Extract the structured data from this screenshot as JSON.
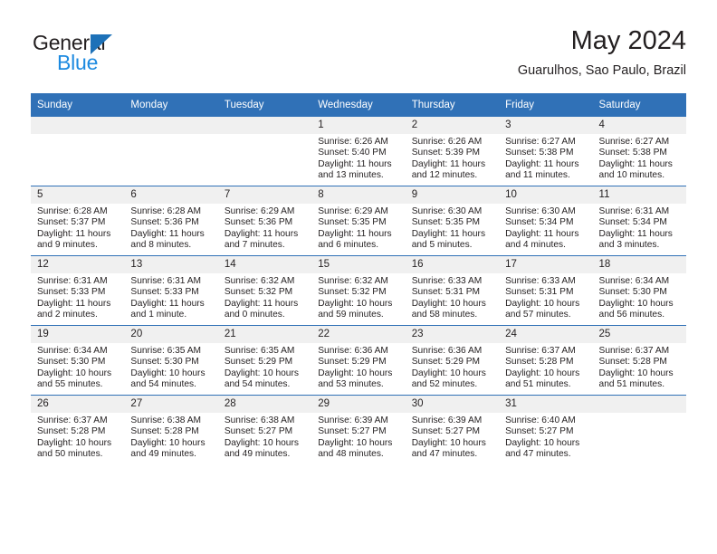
{
  "brand": {
    "name_top": "General",
    "name_bottom": "Blue",
    "triangle_color": "#1d71b8",
    "top_color": "#231f20",
    "bottom_color": "#1d8ae0"
  },
  "header": {
    "title": "May 2024",
    "subtitle": "Guarulhos, Sao Paulo, Brazil"
  },
  "theme": {
    "header_blue": "#3071b7",
    "daynum_band": "#f0f0f0",
    "text": "#231f20"
  },
  "calendar": {
    "weekday_headers": [
      "Sunday",
      "Monday",
      "Tuesday",
      "Wednesday",
      "Thursday",
      "Friday",
      "Saturday"
    ],
    "weeks": [
      [
        {
          "day": "",
          "blank": true
        },
        {
          "day": "",
          "blank": true
        },
        {
          "day": "",
          "blank": true
        },
        {
          "day": "1",
          "sunrise": "Sunrise: 6:26 AM",
          "sunset": "Sunset: 5:40 PM",
          "daylight_1": "Daylight: 11 hours",
          "daylight_2": "and 13 minutes."
        },
        {
          "day": "2",
          "sunrise": "Sunrise: 6:26 AM",
          "sunset": "Sunset: 5:39 PM",
          "daylight_1": "Daylight: 11 hours",
          "daylight_2": "and 12 minutes."
        },
        {
          "day": "3",
          "sunrise": "Sunrise: 6:27 AM",
          "sunset": "Sunset: 5:38 PM",
          "daylight_1": "Daylight: 11 hours",
          "daylight_2": "and 11 minutes."
        },
        {
          "day": "4",
          "sunrise": "Sunrise: 6:27 AM",
          "sunset": "Sunset: 5:38 PM",
          "daylight_1": "Daylight: 11 hours",
          "daylight_2": "and 10 minutes."
        }
      ],
      [
        {
          "day": "5",
          "sunrise": "Sunrise: 6:28 AM",
          "sunset": "Sunset: 5:37 PM",
          "daylight_1": "Daylight: 11 hours",
          "daylight_2": "and 9 minutes."
        },
        {
          "day": "6",
          "sunrise": "Sunrise: 6:28 AM",
          "sunset": "Sunset: 5:36 PM",
          "daylight_1": "Daylight: 11 hours",
          "daylight_2": "and 8 minutes."
        },
        {
          "day": "7",
          "sunrise": "Sunrise: 6:29 AM",
          "sunset": "Sunset: 5:36 PM",
          "daylight_1": "Daylight: 11 hours",
          "daylight_2": "and 7 minutes."
        },
        {
          "day": "8",
          "sunrise": "Sunrise: 6:29 AM",
          "sunset": "Sunset: 5:35 PM",
          "daylight_1": "Daylight: 11 hours",
          "daylight_2": "and 6 minutes."
        },
        {
          "day": "9",
          "sunrise": "Sunrise: 6:30 AM",
          "sunset": "Sunset: 5:35 PM",
          "daylight_1": "Daylight: 11 hours",
          "daylight_2": "and 5 minutes."
        },
        {
          "day": "10",
          "sunrise": "Sunrise: 6:30 AM",
          "sunset": "Sunset: 5:34 PM",
          "daylight_1": "Daylight: 11 hours",
          "daylight_2": "and 4 minutes."
        },
        {
          "day": "11",
          "sunrise": "Sunrise: 6:31 AM",
          "sunset": "Sunset: 5:34 PM",
          "daylight_1": "Daylight: 11 hours",
          "daylight_2": "and 3 minutes."
        }
      ],
      [
        {
          "day": "12",
          "sunrise": "Sunrise: 6:31 AM",
          "sunset": "Sunset: 5:33 PM",
          "daylight_1": "Daylight: 11 hours",
          "daylight_2": "and 2 minutes."
        },
        {
          "day": "13",
          "sunrise": "Sunrise: 6:31 AM",
          "sunset": "Sunset: 5:33 PM",
          "daylight_1": "Daylight: 11 hours",
          "daylight_2": "and 1 minute."
        },
        {
          "day": "14",
          "sunrise": "Sunrise: 6:32 AM",
          "sunset": "Sunset: 5:32 PM",
          "daylight_1": "Daylight: 11 hours",
          "daylight_2": "and 0 minutes."
        },
        {
          "day": "15",
          "sunrise": "Sunrise: 6:32 AM",
          "sunset": "Sunset: 5:32 PM",
          "daylight_1": "Daylight: 10 hours",
          "daylight_2": "and 59 minutes."
        },
        {
          "day": "16",
          "sunrise": "Sunrise: 6:33 AM",
          "sunset": "Sunset: 5:31 PM",
          "daylight_1": "Daylight: 10 hours",
          "daylight_2": "and 58 minutes."
        },
        {
          "day": "17",
          "sunrise": "Sunrise: 6:33 AM",
          "sunset": "Sunset: 5:31 PM",
          "daylight_1": "Daylight: 10 hours",
          "daylight_2": "and 57 minutes."
        },
        {
          "day": "18",
          "sunrise": "Sunrise: 6:34 AM",
          "sunset": "Sunset: 5:30 PM",
          "daylight_1": "Daylight: 10 hours",
          "daylight_2": "and 56 minutes."
        }
      ],
      [
        {
          "day": "19",
          "sunrise": "Sunrise: 6:34 AM",
          "sunset": "Sunset: 5:30 PM",
          "daylight_1": "Daylight: 10 hours",
          "daylight_2": "and 55 minutes."
        },
        {
          "day": "20",
          "sunrise": "Sunrise: 6:35 AM",
          "sunset": "Sunset: 5:30 PM",
          "daylight_1": "Daylight: 10 hours",
          "daylight_2": "and 54 minutes."
        },
        {
          "day": "21",
          "sunrise": "Sunrise: 6:35 AM",
          "sunset": "Sunset: 5:29 PM",
          "daylight_1": "Daylight: 10 hours",
          "daylight_2": "and 54 minutes."
        },
        {
          "day": "22",
          "sunrise": "Sunrise: 6:36 AM",
          "sunset": "Sunset: 5:29 PM",
          "daylight_1": "Daylight: 10 hours",
          "daylight_2": "and 53 minutes."
        },
        {
          "day": "23",
          "sunrise": "Sunrise: 6:36 AM",
          "sunset": "Sunset: 5:29 PM",
          "daylight_1": "Daylight: 10 hours",
          "daylight_2": "and 52 minutes."
        },
        {
          "day": "24",
          "sunrise": "Sunrise: 6:37 AM",
          "sunset": "Sunset: 5:28 PM",
          "daylight_1": "Daylight: 10 hours",
          "daylight_2": "and 51 minutes."
        },
        {
          "day": "25",
          "sunrise": "Sunrise: 6:37 AM",
          "sunset": "Sunset: 5:28 PM",
          "daylight_1": "Daylight: 10 hours",
          "daylight_2": "and 51 minutes."
        }
      ],
      [
        {
          "day": "26",
          "sunrise": "Sunrise: 6:37 AM",
          "sunset": "Sunset: 5:28 PM",
          "daylight_1": "Daylight: 10 hours",
          "daylight_2": "and 50 minutes."
        },
        {
          "day": "27",
          "sunrise": "Sunrise: 6:38 AM",
          "sunset": "Sunset: 5:28 PM",
          "daylight_1": "Daylight: 10 hours",
          "daylight_2": "and 49 minutes."
        },
        {
          "day": "28",
          "sunrise": "Sunrise: 6:38 AM",
          "sunset": "Sunset: 5:27 PM",
          "daylight_1": "Daylight: 10 hours",
          "daylight_2": "and 49 minutes."
        },
        {
          "day": "29",
          "sunrise": "Sunrise: 6:39 AM",
          "sunset": "Sunset: 5:27 PM",
          "daylight_1": "Daylight: 10 hours",
          "daylight_2": "and 48 minutes."
        },
        {
          "day": "30",
          "sunrise": "Sunrise: 6:39 AM",
          "sunset": "Sunset: 5:27 PM",
          "daylight_1": "Daylight: 10 hours",
          "daylight_2": "and 47 minutes."
        },
        {
          "day": "31",
          "sunrise": "Sunrise: 6:40 AM",
          "sunset": "Sunset: 5:27 PM",
          "daylight_1": "Daylight: 10 hours",
          "daylight_2": "and 47 minutes."
        },
        {
          "day": "",
          "blank": true
        }
      ]
    ]
  }
}
